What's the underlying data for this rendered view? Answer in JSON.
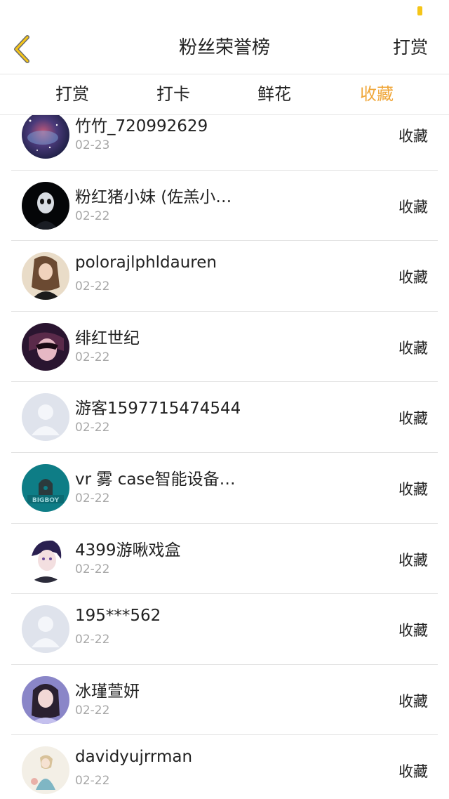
{
  "nav": {
    "title": "粉丝荣誉榜",
    "action": "打赏"
  },
  "tabs": [
    {
      "label": "打赏",
      "active": false
    },
    {
      "label": "打卡",
      "active": false
    },
    {
      "label": "鲜花",
      "active": false
    },
    {
      "label": "收藏",
      "active": true
    }
  ],
  "colors": {
    "accent": "#f0a73a",
    "battery": "#f5c518",
    "divider": "#e3e3e3",
    "date_text": "#a7a7a7"
  },
  "items": [
    {
      "name": "竹竹_720992629",
      "date": "02-23",
      "action": "收藏",
      "avatar": "galaxy-avatar"
    },
    {
      "name": "粉红猪小妹 (佐羔小…",
      "date": "02-22",
      "action": "收藏",
      "avatar": "masked-figure-avatar"
    },
    {
      "name": "polorajlphldauren",
      "date": "02-22",
      "action": "收藏",
      "avatar": "girl-photo-avatar"
    },
    {
      "name": "绯红世纪",
      "date": "02-22",
      "action": "收藏",
      "avatar": "masked-woman-avatar"
    },
    {
      "name": "游客1597715474544",
      "date": "02-22",
      "action": "收藏",
      "avatar": "default-user-avatar"
    },
    {
      "name": "vr 雾 case智能设备…",
      "date": "02-22",
      "action": "收藏",
      "avatar": "bigboy-logo-avatar"
    },
    {
      "name": "4399游啾戏盒",
      "date": "02-22",
      "action": "收藏",
      "avatar": "anime-boy-avatar"
    },
    {
      "name": "195***562",
      "date": "02-22",
      "action": "收藏",
      "avatar": "default-user-avatar"
    },
    {
      "name": "冰瑾萱妍",
      "date": "02-22",
      "action": "收藏",
      "avatar": "girl-portrait-avatar"
    },
    {
      "name": "davidyujrrman",
      "date": "02-22",
      "action": "收藏",
      "avatar": "illustration-avatar"
    }
  ]
}
